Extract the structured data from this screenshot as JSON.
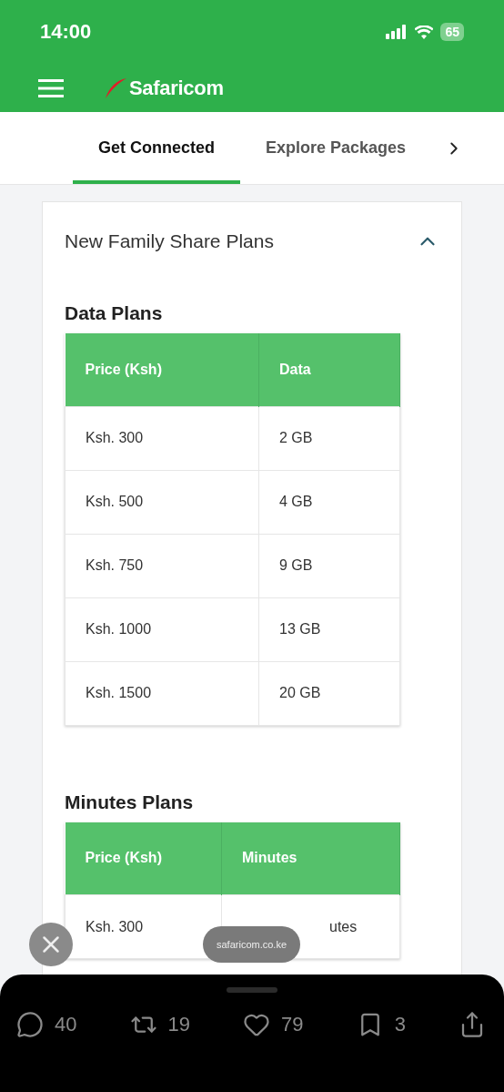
{
  "status_bar": {
    "time": "14:00",
    "battery": "65"
  },
  "header": {
    "logo": "Safaricom"
  },
  "tabs": [
    {
      "label": "Get Connected",
      "selected": true
    },
    {
      "label": "Explore Packages",
      "selected": false
    }
  ],
  "accordion": {
    "title": "New Family Share Plans",
    "expanded": true,
    "sections": [
      {
        "heading": "Data Plans",
        "columns": [
          "Price (Ksh)",
          "Data"
        ],
        "rows": [
          [
            "Ksh. 300",
            "2 GB"
          ],
          [
            "Ksh. 500",
            "4 GB"
          ],
          [
            "Ksh. 750",
            "9 GB"
          ],
          [
            "Ksh. 1000",
            "13 GB"
          ],
          [
            "Ksh. 1500",
            "20 GB"
          ]
        ]
      },
      {
        "heading": "Minutes Plans",
        "columns": [
          "Price (Ksh)",
          "Minutes"
        ],
        "rows": [
          [
            "Ksh. 300",
            "utes"
          ]
        ]
      }
    ]
  },
  "url_pill": "safaricom.co.ke",
  "actions": [
    {
      "kind": "reply",
      "count": "40"
    },
    {
      "kind": "repost",
      "count": "19"
    },
    {
      "kind": "like",
      "count": "79"
    },
    {
      "kind": "bookmark",
      "count": "3"
    },
    {
      "kind": "share"
    }
  ]
}
